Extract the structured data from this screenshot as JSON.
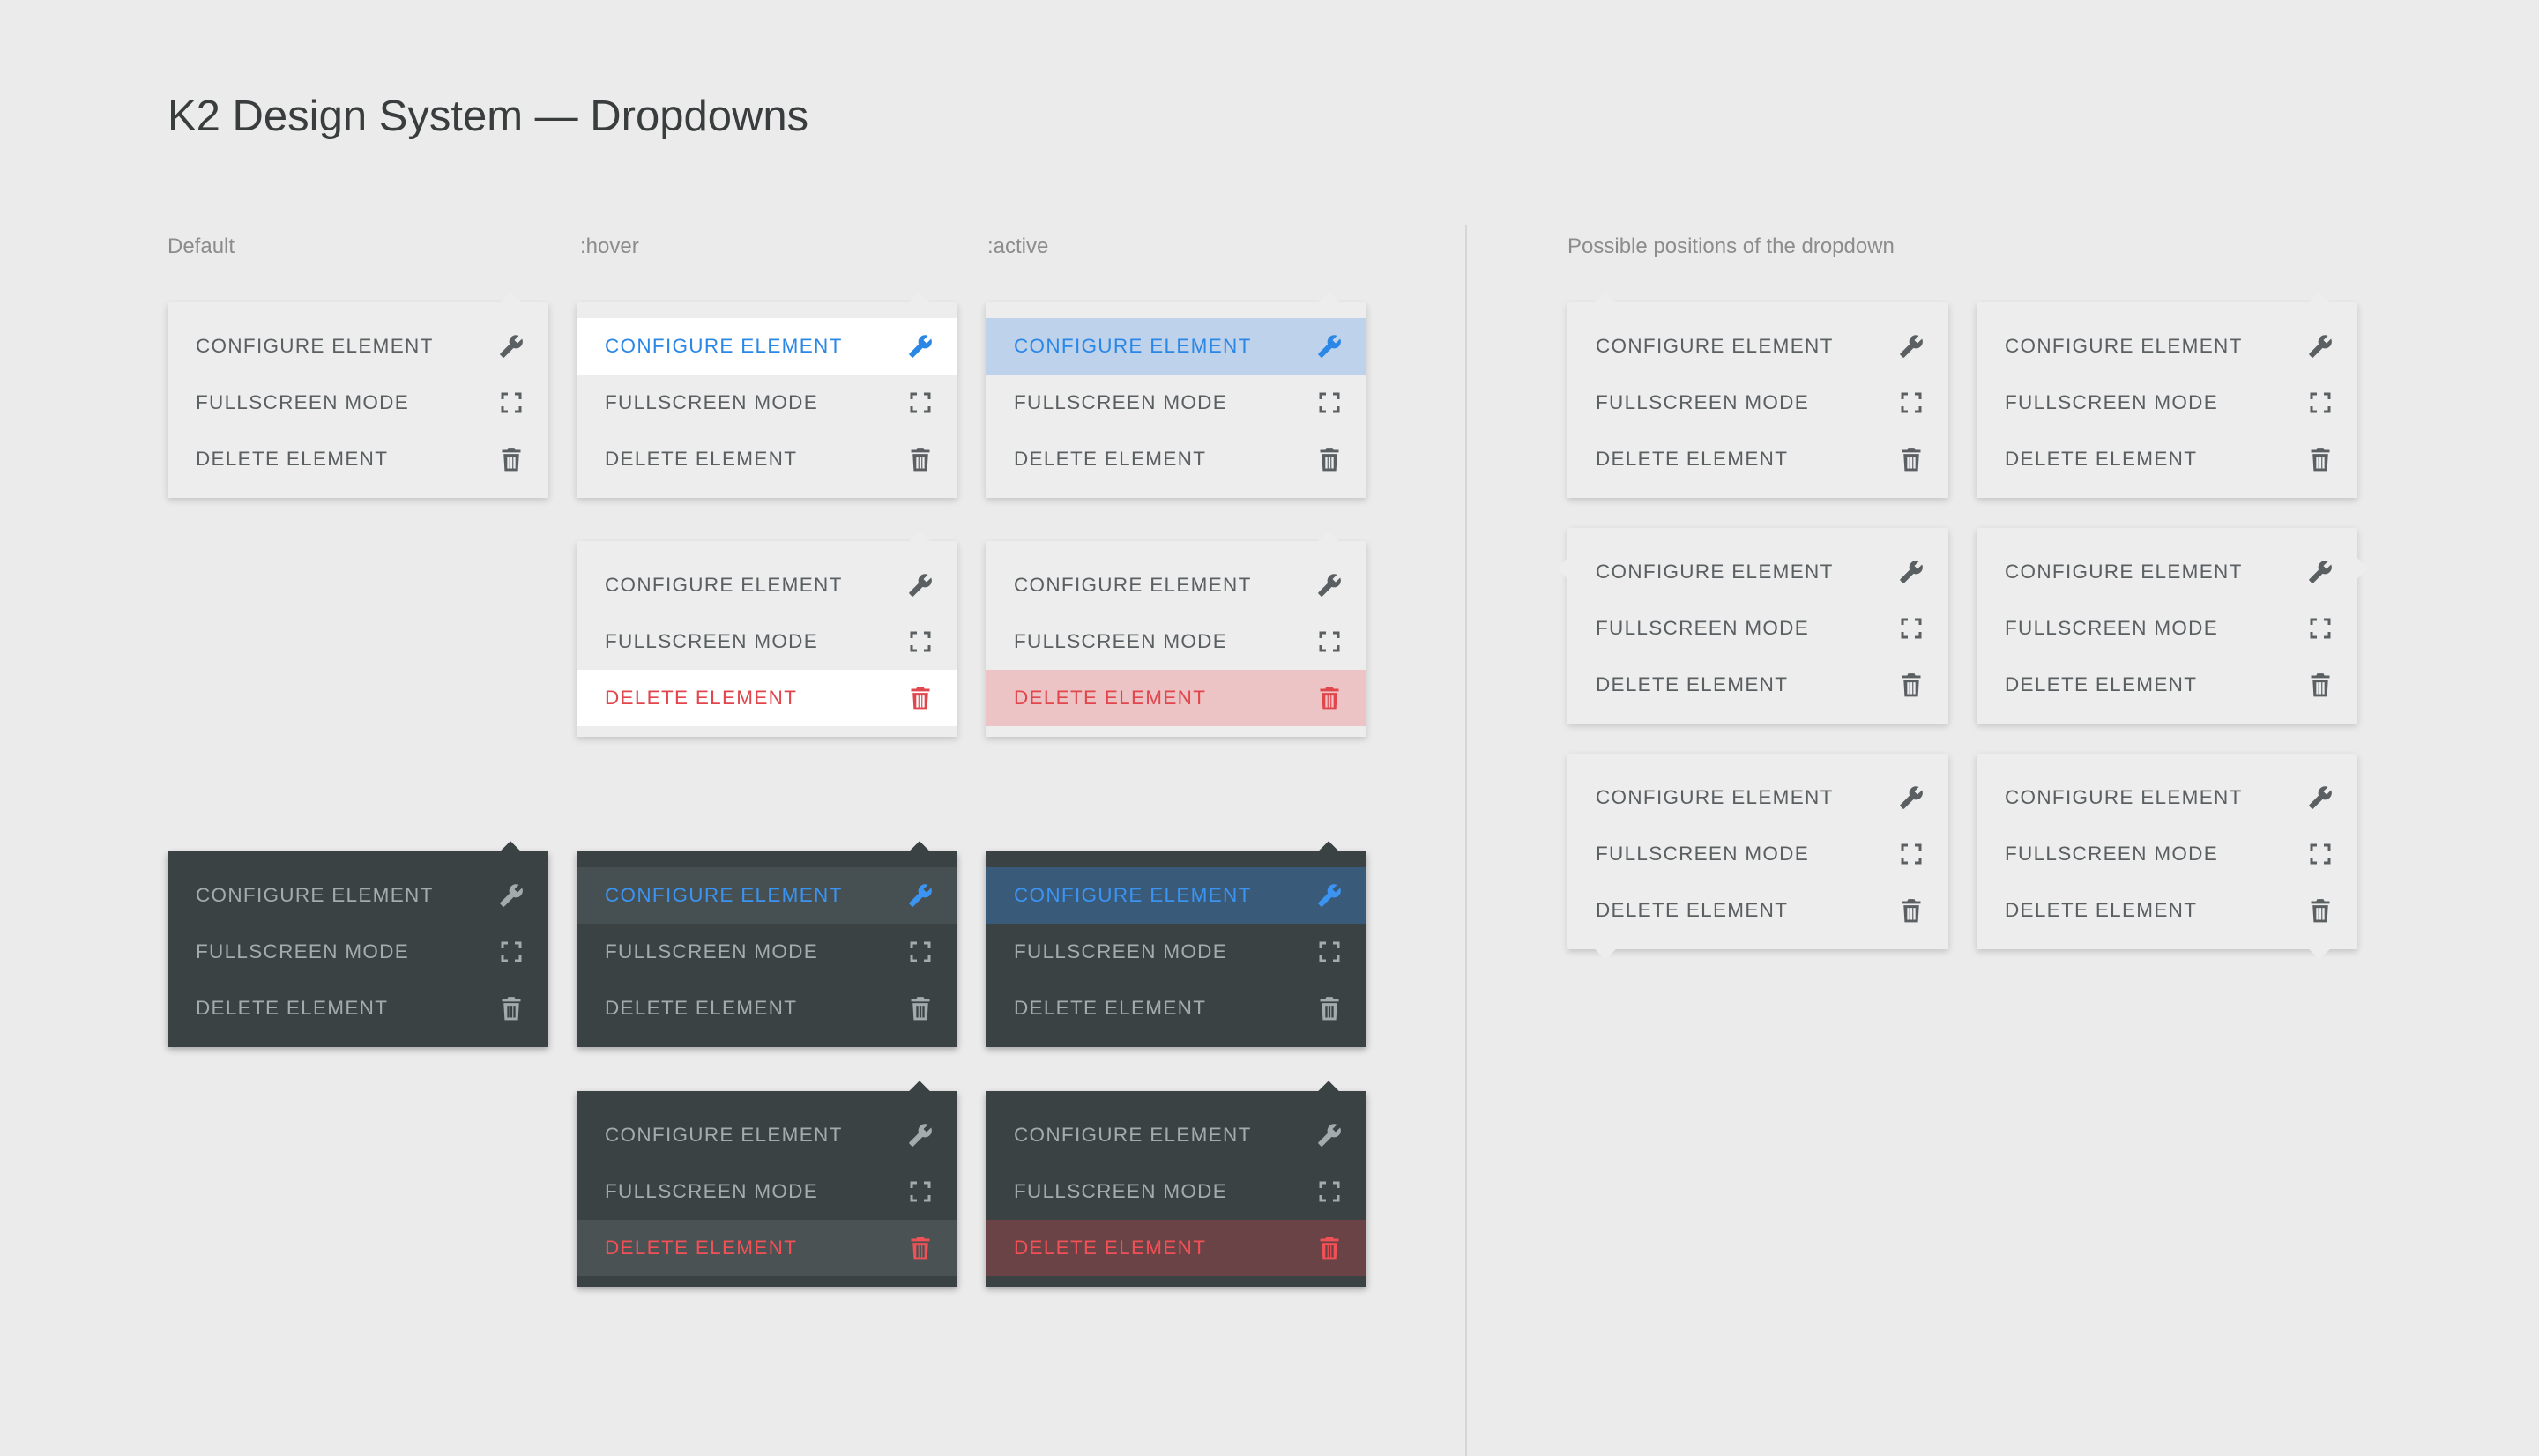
{
  "page": {
    "title": "K2 Design System — Dropdowns"
  },
  "sections": {
    "default": "Default",
    "hover": ":hover",
    "active": ":active",
    "positions": "Possible positions of the dropdown"
  },
  "menu": {
    "items": [
      {
        "label": "CONFIGURE ELEMENT",
        "icon": "wrench-icon"
      },
      {
        "label": "FULLSCREEN MODE",
        "icon": "fullscreen-icon"
      },
      {
        "label": "DELETE ELEMENT",
        "icon": "trash-icon"
      }
    ]
  },
  "colors": {
    "background": "#ebebeb",
    "light_surface": "#ededed",
    "dark_surface": "#3b4244",
    "accent_blue": "#2b87e6",
    "danger_red": "#e0464c",
    "active_blue_bg": "#bed2ec",
    "active_red_bg": "#edc4c5"
  }
}
